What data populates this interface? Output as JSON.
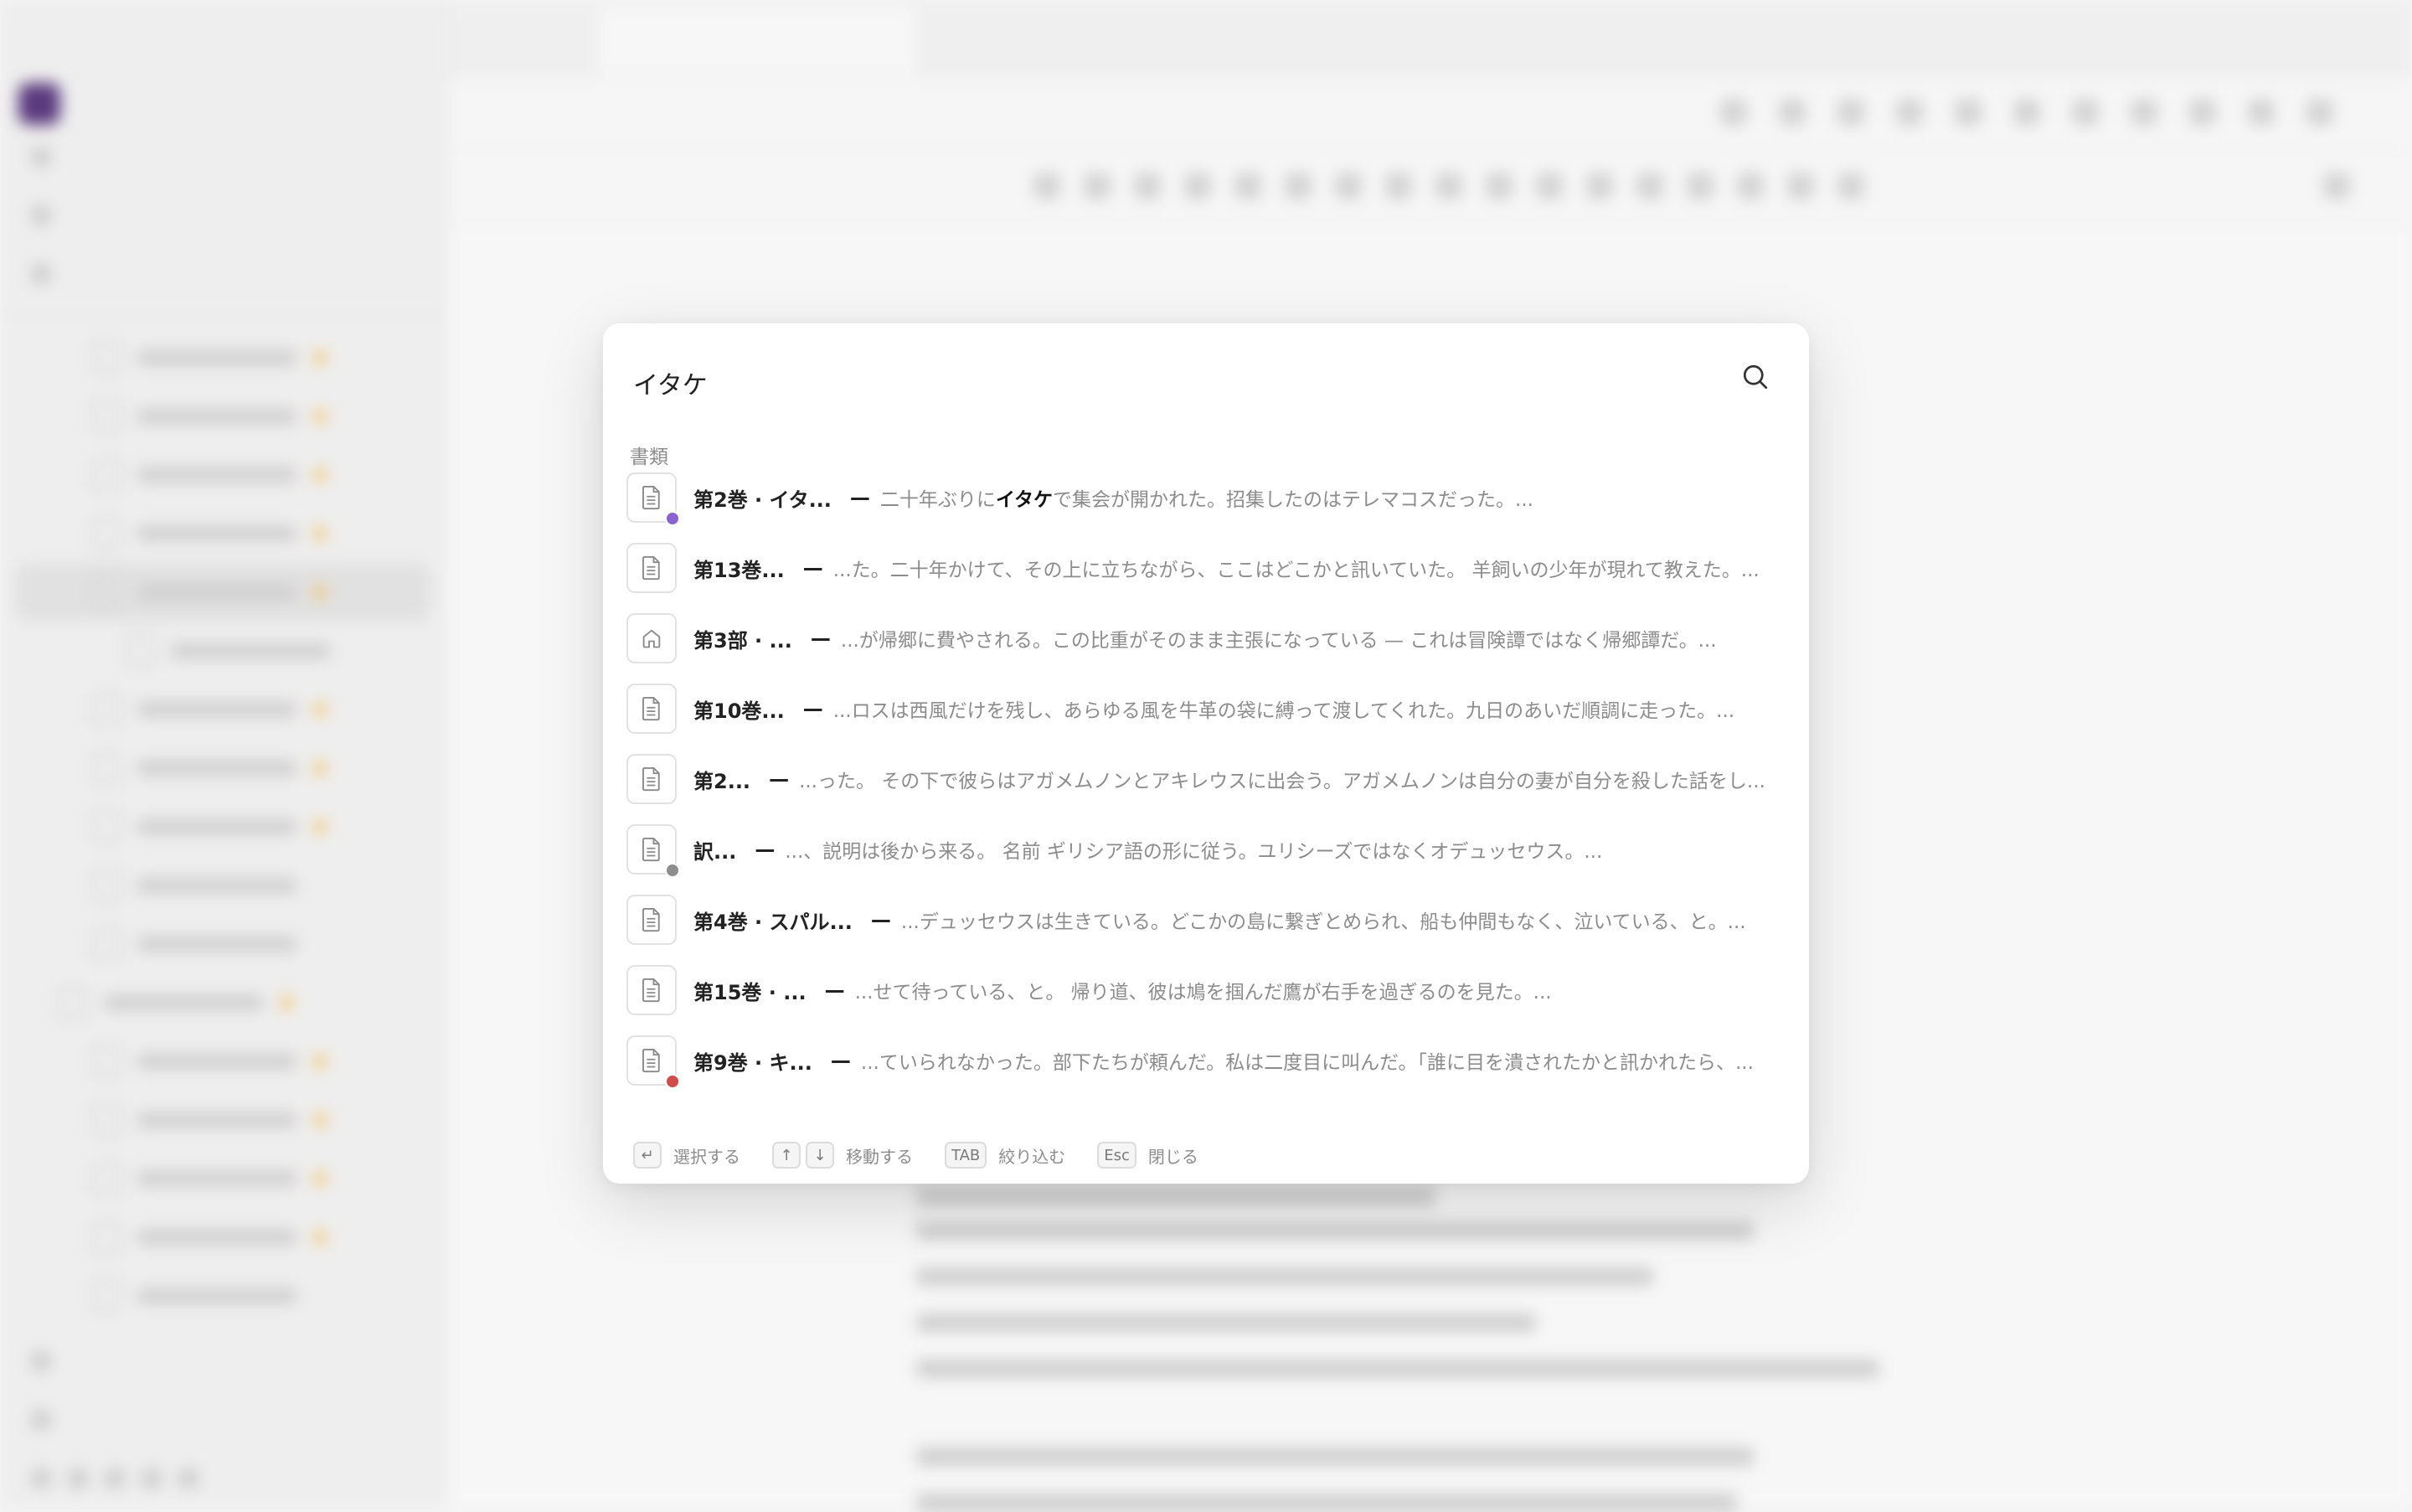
{
  "search": {
    "query": "イタケ",
    "section_label": "書類"
  },
  "results": [
    {
      "title": "第2巻 · イタ...",
      "snippet_before": "二十年ぶりに",
      "highlight": "イタケ",
      "snippet_after": "で集会が開かれた。招集したのはテレマコスだった。...",
      "icon": "document-icon",
      "status_color": "#8a63d2"
    },
    {
      "title": "第13巻...",
      "snippet_before": "...た。二十年かけて、その上に立ちながら、ここはどこかと訊いていた。 羊飼いの少年が現れて教えた。...",
      "highlight": "",
      "snippet_after": "",
      "icon": "document-icon",
      "status_color": ""
    },
    {
      "title": "第3部 · ...",
      "snippet_before": "...が帰郷に費やされる。この比重がそのまま主張になっている — これは冒険譚ではなく帰郷譚だ。...",
      "highlight": "",
      "snippet_after": "",
      "icon": "home-icon",
      "status_color": ""
    },
    {
      "title": "第10巻...",
      "snippet_before": "...ロスは西風だけを残し、あらゆる風を牛革の袋に縛って渡してくれた。九日のあいだ順調に走った。...",
      "highlight": "",
      "snippet_after": "",
      "icon": "document-icon",
      "status_color": ""
    },
    {
      "title": "第2...",
      "snippet_before": "...った。 その下で彼らはアガメムノンとアキレウスに出会う。アガメムノンは自分の妻が自分を殺した話をし...",
      "highlight": "",
      "snippet_after": "",
      "icon": "document-icon",
      "status_color": ""
    },
    {
      "title": "訳...",
      "snippet_before": "...、説明は後から来る。 名前 ギリシア語の形に従う。ユリシーズではなくオデュッセウス。...",
      "highlight": "",
      "snippet_after": "",
      "icon": "document-icon",
      "status_color": "#8e8e8e"
    },
    {
      "title": "第4巻 · スパル...",
      "snippet_before": "...デュッセウスは生きている。どこかの島に繋ぎとめられ、船も仲間もなく、泣いている、と。...",
      "highlight": "",
      "snippet_after": "",
      "icon": "document-icon",
      "status_color": ""
    },
    {
      "title": "第15巻 · ...",
      "snippet_before": "...せて待っている、と。 帰り道、彼は鳩を掴んだ鷹が右手を過ぎるのを見た。...",
      "highlight": "",
      "snippet_after": "",
      "icon": "document-icon",
      "status_color": ""
    },
    {
      "title": "第9巻 · キ...",
      "snippet_before": "...ていられなかった。部下たちが頼んだ。私は二度目に叫んだ。「誰に目を潰されたかと訊かれたら、...",
      "highlight": "",
      "snippet_after": "",
      "icon": "document-icon",
      "status_color": "#d24b4b"
    }
  ],
  "footer": {
    "select_key": "↵",
    "select_label": "選択する",
    "up_key": "↑",
    "down_key": "↓",
    "move_label": "移動する",
    "tab_key": "TAB",
    "filter_label": "絞り込む",
    "esc_key": "Esc",
    "close_label": "閉じる"
  },
  "colors": {
    "accent_purple": "#8a63d2",
    "status_gray": "#8e8e8e",
    "status_red": "#d24b4b",
    "star_yellow": "#f3c46b"
  }
}
